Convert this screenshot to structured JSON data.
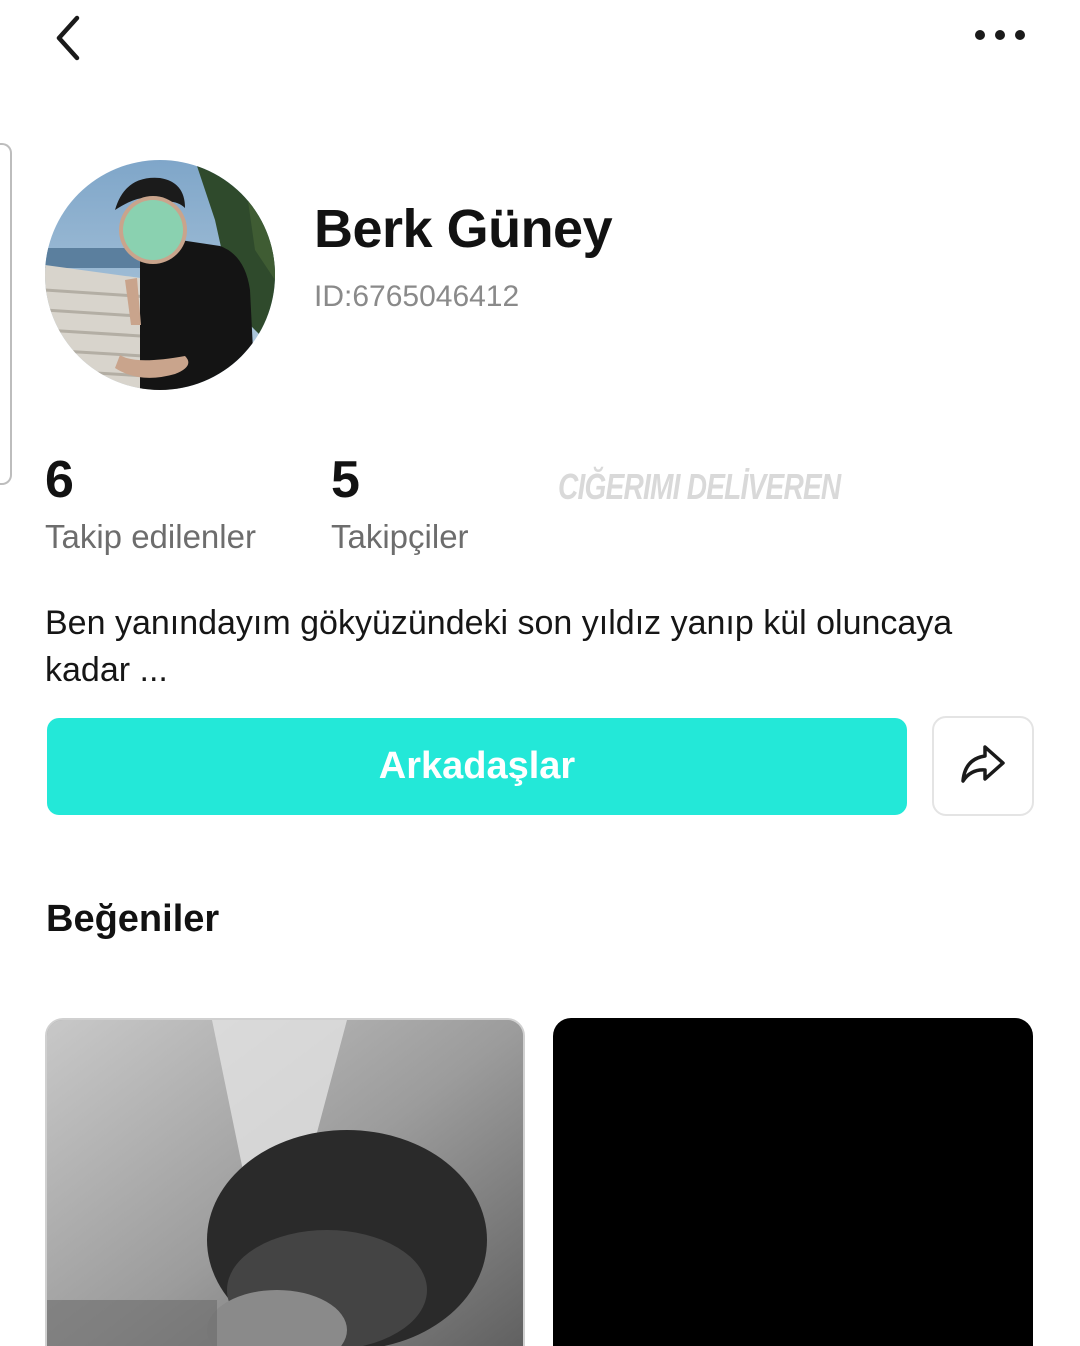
{
  "profile": {
    "name": "Berk Güney",
    "id_text": "ID:6765046412",
    "bio": "Ben yanındayım gökyüzündeki son yıldız yanıp kül oluncaya kadar ..."
  },
  "stats": {
    "following_count": "6",
    "following_label": "Takip edilenler",
    "followers_count": "5",
    "followers_label": "Takipçiler"
  },
  "watermark": "CIĞERIMI DELİVEREN",
  "actions": {
    "friends_label": "Arkadaşlar"
  },
  "likes": {
    "title": "Beğeniler"
  },
  "icons": {
    "back": "chevron-left-icon",
    "more": "more-horizontal-icon",
    "share": "share-icon"
  },
  "colors": {
    "accent": "#23e8d8",
    "name_text": "#121212",
    "muted_text": "#8a8a8a"
  }
}
